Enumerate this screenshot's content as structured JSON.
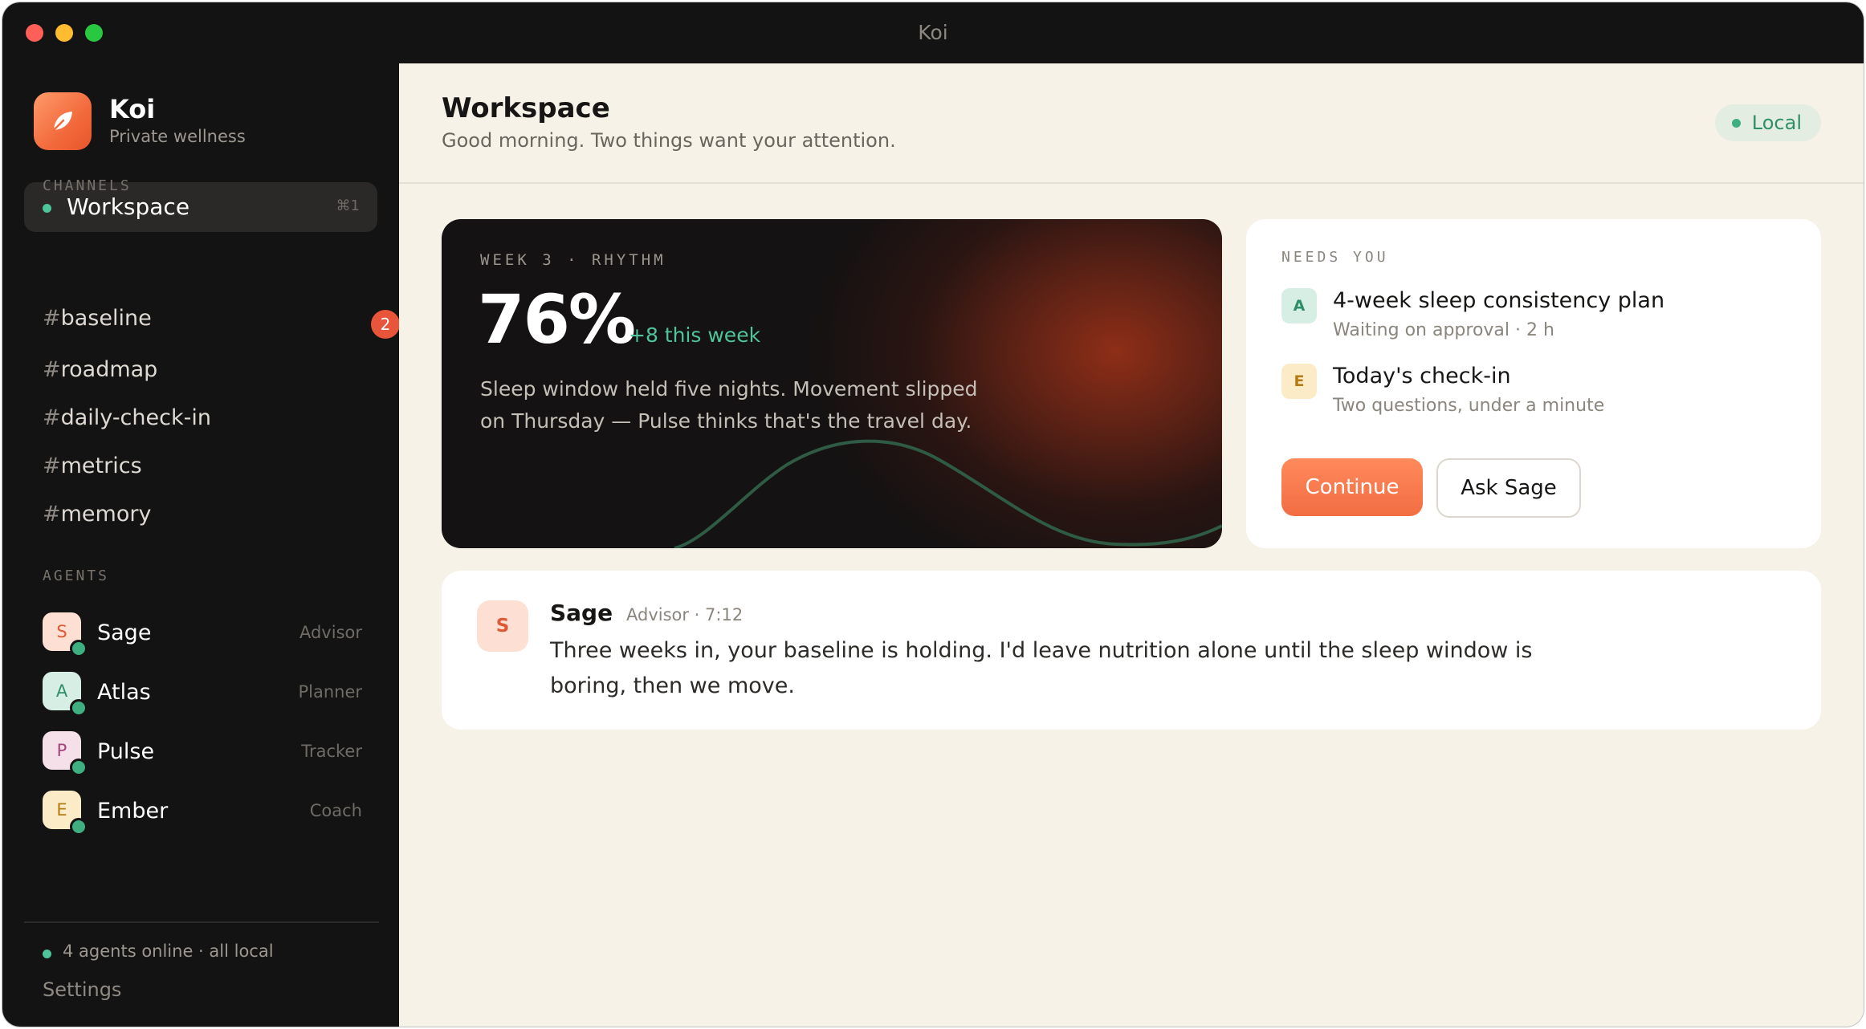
{
  "window": {
    "title": "Koi"
  },
  "sidebar": {
    "app_name": "Koi",
    "app_subtitle": "Private wellness",
    "active_item": {
      "label": "Workspace",
      "shortcut": "⌘1"
    },
    "channels_heading": "CHANNELS",
    "channels": [
      {
        "hash": "#",
        "name": "baseline",
        "badge": "2"
      },
      {
        "hash": "#",
        "name": "roadmap"
      },
      {
        "hash": "#",
        "name": "daily-check-in"
      },
      {
        "hash": "#",
        "name": "metrics"
      },
      {
        "hash": "#",
        "name": "memory"
      }
    ],
    "agents_heading": "AGENTS",
    "agents": [
      {
        "initial": "S",
        "name": "Sage",
        "role": "Advisor"
      },
      {
        "initial": "A",
        "name": "Atlas",
        "role": "Planner"
      },
      {
        "initial": "P",
        "name": "Pulse",
        "role": "Tracker"
      },
      {
        "initial": "E",
        "name": "Ember",
        "role": "Coach"
      }
    ],
    "footer_status": "4 agents online · all local",
    "settings_label": "Settings"
  },
  "header": {
    "title": "Workspace",
    "subtitle": "Good morning. Two things want your attention.",
    "status_pill": "Local"
  },
  "hero": {
    "kicker": "WEEK 3 · RHYTHM",
    "value": "76%",
    "delta": "+8 this week",
    "text": "Sleep window held five nights. Movement slipped on Thursday — Pulse thinks that's the travel day."
  },
  "needs_you": {
    "heading": "NEEDS YOU",
    "tasks": [
      {
        "initial": "A",
        "title": "4-week sleep consistency plan",
        "meta": "Waiting on approval · 2 h"
      },
      {
        "initial": "E",
        "title": "Today's check-in",
        "meta": "Two questions, under a minute"
      }
    ],
    "primary_button": "Continue",
    "secondary_button": "Ask Sage"
  },
  "message": {
    "avatar_initial": "S",
    "author": "Sage",
    "meta": "Advisor · 7:12",
    "text": "Three weeks in, your baseline is holding. I'd leave nutrition alone until the sleep window is boring, then we move."
  },
  "colors": {
    "accent": "#f26d42",
    "online": "#4fc39a",
    "badge": "#e8553a",
    "sidebar_bg": "#141313",
    "main_bg": "#f7f2e8"
  },
  "icons": {
    "logo": "leaf-icon"
  }
}
